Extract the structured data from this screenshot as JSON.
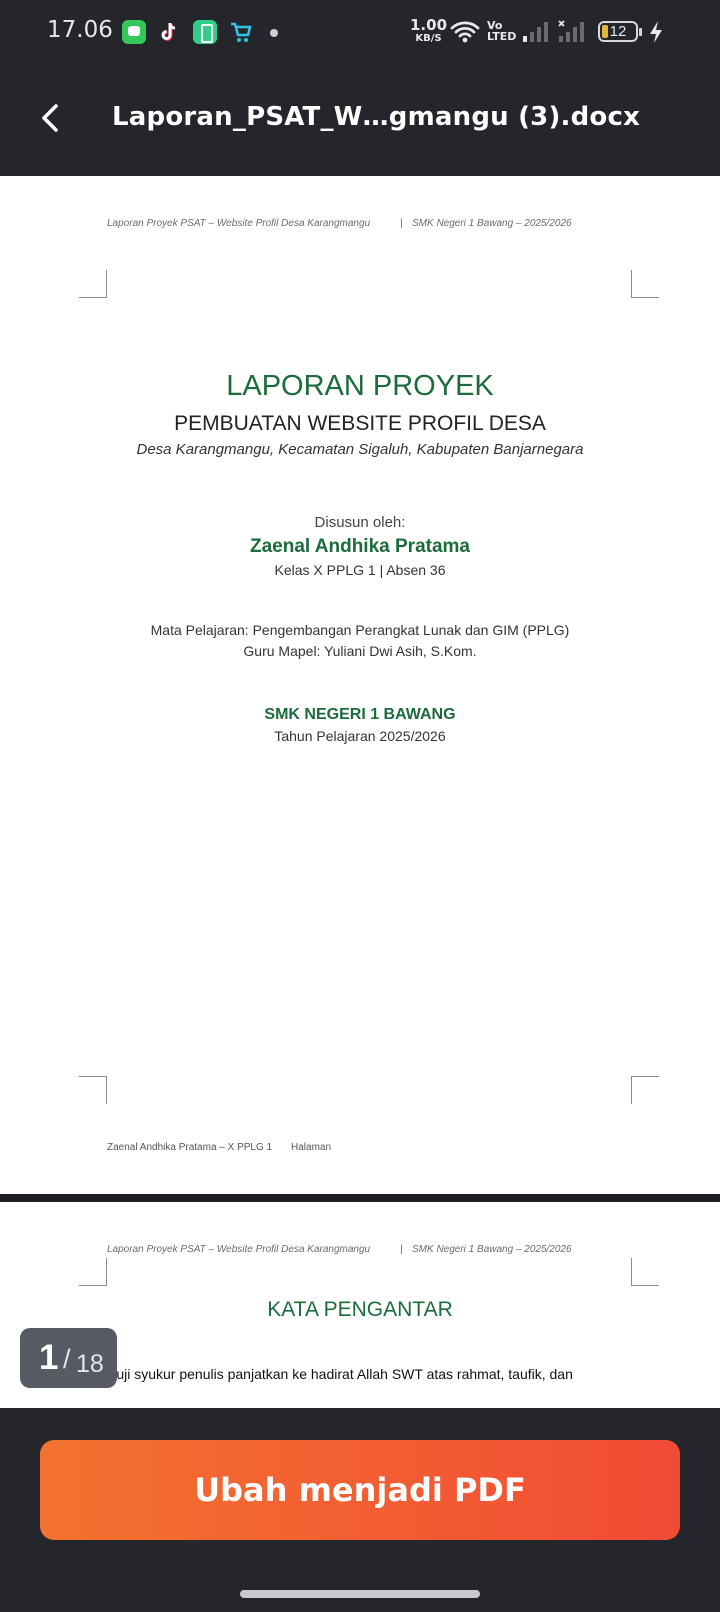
{
  "status_bar": {
    "time": "17.06",
    "net_speed": "1.00",
    "net_speed_unit": "KB/S",
    "volte_label_1": "Vo",
    "volte_label_2": "LTED",
    "battery_level": "12",
    "notification_icons": [
      "messages-icon",
      "tiktok-icon",
      "battery-saver-icon",
      "shopping-cart-icon"
    ]
  },
  "app_bar": {
    "title": "Laporan_PSAT_W…gmangu (3).docx",
    "back_icon": "chevron-left-icon"
  },
  "document": {
    "running_header_left": "Laporan Proyek PSAT – Website Profil Desa Karangmangu",
    "running_header_sep": "|",
    "running_header_right": "SMK Negeri 1 Bawang – 2025/2026",
    "page1": {
      "title": "LAPORAN PROYEK",
      "subtitle": "PEMBUATAN WEBSITE PROFIL DESA",
      "location": "Desa Karangmangu, Kecamatan Sigaluh, Kabupaten Banjarnegara",
      "compiled_by": "Disusun oleh:",
      "author": "Zaenal Andhika Pratama",
      "class_info": "Kelas X PPLG 1  |  Absen 36",
      "subject": "Mata Pelajaran: Pengembangan Perangkat Lunak dan GIM (PPLG)",
      "teacher": "Guru Mapel: Yuliani Dwi Asih, S.Kom.",
      "school": "SMK NEGERI 1 BAWANG",
      "year": "Tahun Pelajaran 2025/2026",
      "footer_left": "Zaenal Andhika Pratama – X PPLG 1",
      "footer_right": "Halaman"
    },
    "page2": {
      "heading": "KATA PENGANTAR",
      "first_line": "Puji syukur penulis panjatkan ke hadirat Allah SWT atas rahmat, taufik, dan"
    }
  },
  "page_counter": {
    "current": "1",
    "separator": "/",
    "total": "18"
  },
  "bottom_bar": {
    "convert_label": "Ubah menjadi PDF"
  },
  "colors": {
    "accent_green": "#1c6b3c",
    "button_start": "#f3722f",
    "button_end": "#f14b35",
    "bar_bg": "#25262b"
  }
}
